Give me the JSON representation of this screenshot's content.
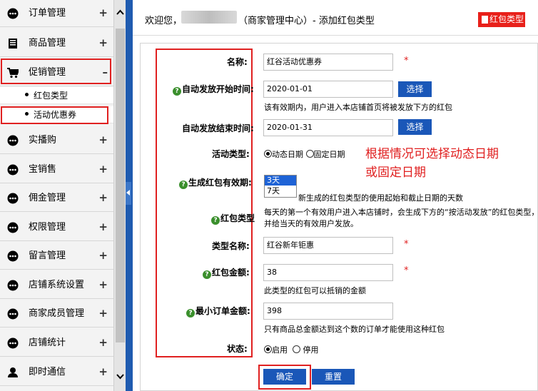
{
  "sidebar": {
    "items": [
      {
        "label": "订单管理",
        "toggle": "+"
      },
      {
        "label": "商品管理",
        "toggle": "+"
      },
      {
        "label": "促销管理",
        "toggle": "–"
      },
      {
        "label": "实播购",
        "toggle": "+"
      },
      {
        "label": "宝销售",
        "toggle": "+"
      },
      {
        "label": "佣金管理",
        "toggle": "+"
      },
      {
        "label": "权限管理",
        "toggle": "+"
      },
      {
        "label": "留言管理",
        "toggle": "+"
      },
      {
        "label": "店铺系统设置",
        "toggle": "+"
      },
      {
        "label": "商家成员管理",
        "toggle": "+"
      },
      {
        "label": "店铺统计",
        "toggle": "+"
      },
      {
        "label": "即时通信",
        "toggle": "+"
      }
    ],
    "sub_items": [
      {
        "label": "红包类型"
      },
      {
        "label": "活动优惠券"
      }
    ]
  },
  "header": {
    "welcome": "欢迎您，",
    "title": "（商家管理中心）- 添加红包类型",
    "button_label": "红包类型"
  },
  "form": {
    "name_label": "名称:",
    "name_value": "红谷活动优惠券",
    "start_label": "自动发放开始时间:",
    "start_value": "2020-01-01",
    "start_hint": "该有效期内，用户进入本店铺首页将被发放下方的红包",
    "end_label": "自动发放结束时间:",
    "end_value": "2020-01-31",
    "choose_label": "选择",
    "activity_type_label": "活动类型:",
    "activity_opt_dynamic": "动态日期",
    "activity_opt_fixed": "固定日期",
    "validity_label": "生成红包有效期:",
    "validity_options": [
      "3天",
      "7天"
    ],
    "validity_hint": "新生成的红包类型的使用起始和截止日期的天数",
    "redpack_type_label": "红包类型",
    "redpack_hint_1": "每天的第一个有效用户进入本店铺时，会生成下方的“按活动发放”的红包类型，",
    "redpack_hint_2": "并给当天的有效用户发放。",
    "type_name_label": "类型名称:",
    "type_name_value": "红谷新年钜惠",
    "amount_label": "红包金额:",
    "amount_value": "38",
    "amount_hint": "此类型的红包可以抵销的金额",
    "min_order_label": "最小订单金额:",
    "min_order_value": "398",
    "min_order_hint": "只有商品总金额达到这个数的订单才能使用这种红包",
    "status_label": "状态:",
    "status_on": "启用",
    "status_off": "停用",
    "required_mark": "*",
    "help_glyph": "?"
  },
  "annotation": {
    "line1": "根据情况可选择动态日期",
    "line2": "或固定日期"
  },
  "actions": {
    "confirm_label": "确定",
    "reset_label": "重置"
  },
  "colors": {
    "accent_blue": "#1a57b8",
    "alert_red": "#e02020",
    "help_green": "#3a8f2c"
  }
}
